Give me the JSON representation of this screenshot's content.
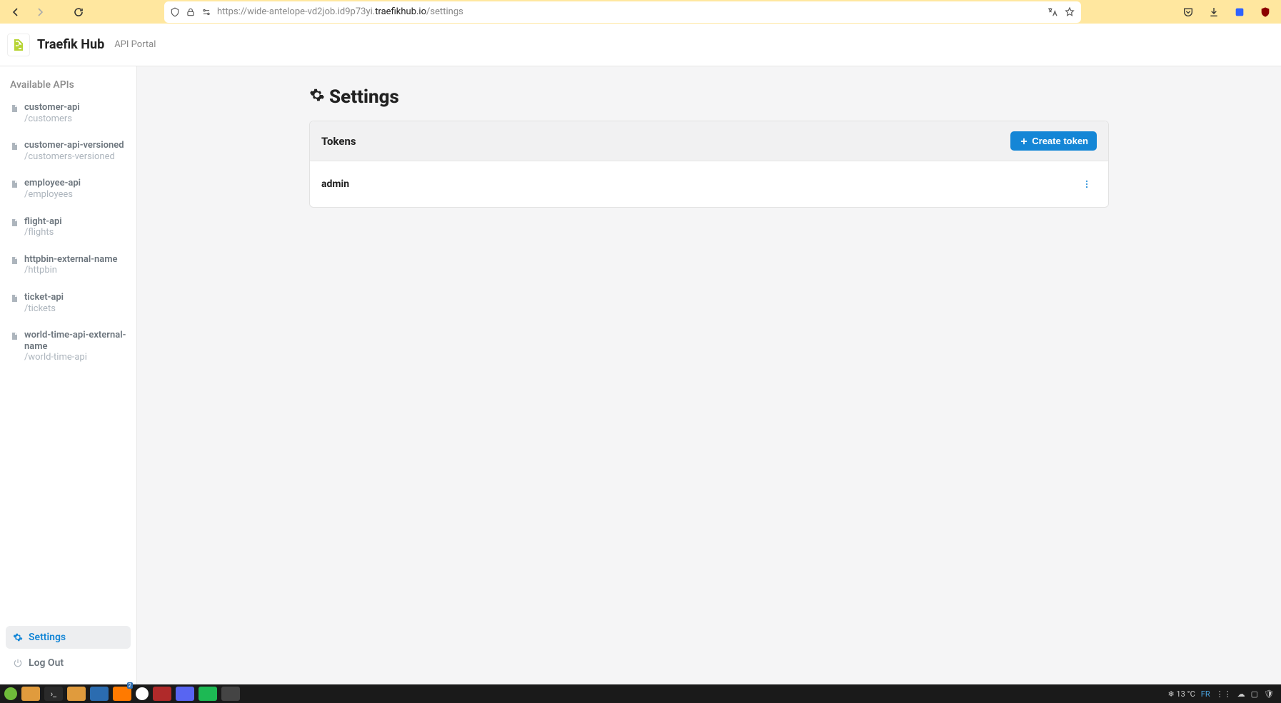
{
  "browser": {
    "url_prefix": "https://wide-antelope-vd2job.id9p73yi.",
    "url_host": "traefikhub.io",
    "url_path": "/settings"
  },
  "app": {
    "brand": "Traefik Hub",
    "subtitle": "API Portal"
  },
  "sidebar": {
    "title": "Available APIs",
    "apis": [
      {
        "name": "customer-api",
        "path": "/customers"
      },
      {
        "name": "customer-api-versioned",
        "path": "/customers-versioned"
      },
      {
        "name": "employee-api",
        "path": "/employees"
      },
      {
        "name": "flight-api",
        "path": "/flights"
      },
      {
        "name": "httpbin-external-name",
        "path": "/httpbin"
      },
      {
        "name": "ticket-api",
        "path": "/tickets"
      },
      {
        "name": "world-time-api-external-name",
        "path": "/world-time-api"
      }
    ],
    "settings_label": "Settings",
    "logout_label": "Log Out"
  },
  "main": {
    "title": "Settings",
    "tokens_section_title": "Tokens",
    "create_token_label": "Create token",
    "tokens": [
      {
        "name": "admin"
      }
    ]
  },
  "taskbar": {
    "temp": "13 °C",
    "lang": "FR"
  },
  "colors": {
    "accent": "#1486d6",
    "chrome_bg": "#ffe79f"
  }
}
